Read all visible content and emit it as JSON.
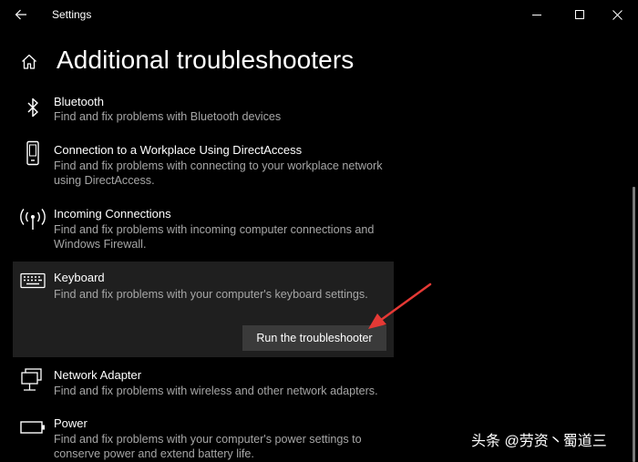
{
  "window": {
    "title": "Settings"
  },
  "page": {
    "title": "Additional troubleshooters"
  },
  "items": [
    {
      "name": "Bluetooth",
      "description": "Find and fix problems with Bluetooth devices",
      "icon": "bluetooth-icon"
    },
    {
      "name": "Connection to a Workplace Using DirectAccess",
      "description": "Find and fix problems with connecting to your workplace network using DirectAccess.",
      "icon": "phone-icon"
    },
    {
      "name": "Incoming Connections",
      "description": "Find and fix problems with incoming computer connections and Windows Firewall.",
      "icon": "antenna-icon"
    },
    {
      "name": "Keyboard",
      "description": "Find and fix problems with your computer's keyboard settings.",
      "icon": "keyboard-icon",
      "button": "Run the troubleshooter"
    },
    {
      "name": "Network Adapter",
      "description": "Find and fix problems with wireless and other network adapters.",
      "icon": "network-icon"
    },
    {
      "name": "Power",
      "description": "Find and fix problems with your computer's power settings to conserve power and extend battery life.",
      "icon": "battery-icon"
    }
  ],
  "watermark": "头条 @劳资丶蜀道三",
  "colors": {
    "background": "#000000",
    "description": "#a6a6a6",
    "selected": "#1f1f1f",
    "button": "#3a3a3a",
    "arrow": "#e53935"
  }
}
